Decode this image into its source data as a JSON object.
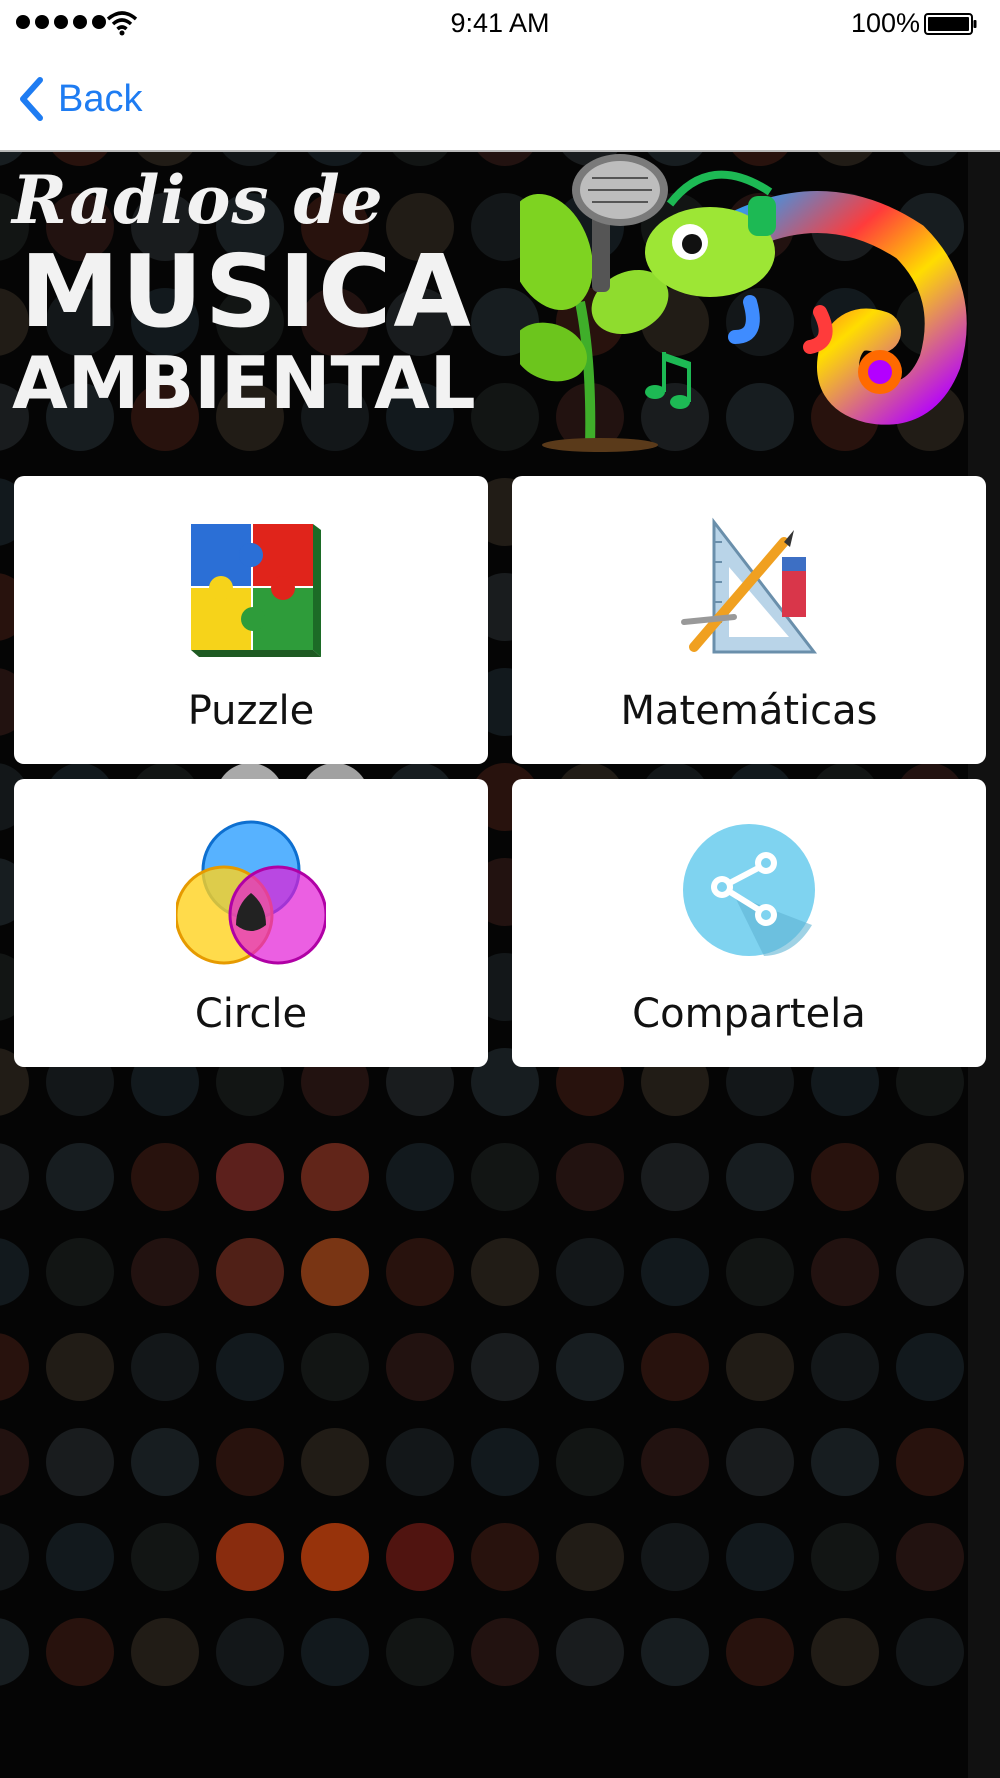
{
  "status_bar": {
    "time": "9:41 AM",
    "battery": "100%"
  },
  "nav": {
    "back_label": "Back"
  },
  "banner": {
    "line1": "Radios de",
    "line2": "MUSICA",
    "line3": "AMBIENTAL"
  },
  "menu": [
    {
      "label": "Puzzle",
      "icon": "puzzle-icon"
    },
    {
      "label": "Matemáticas",
      "icon": "math-tools-icon"
    },
    {
      "label": "Circle",
      "icon": "color-circles-icon"
    },
    {
      "label": "Compartela",
      "icon": "share-icon"
    }
  ],
  "colors": {
    "accent": "#1e7cf2",
    "background": "#050505",
    "tile": "#ffffff"
  }
}
